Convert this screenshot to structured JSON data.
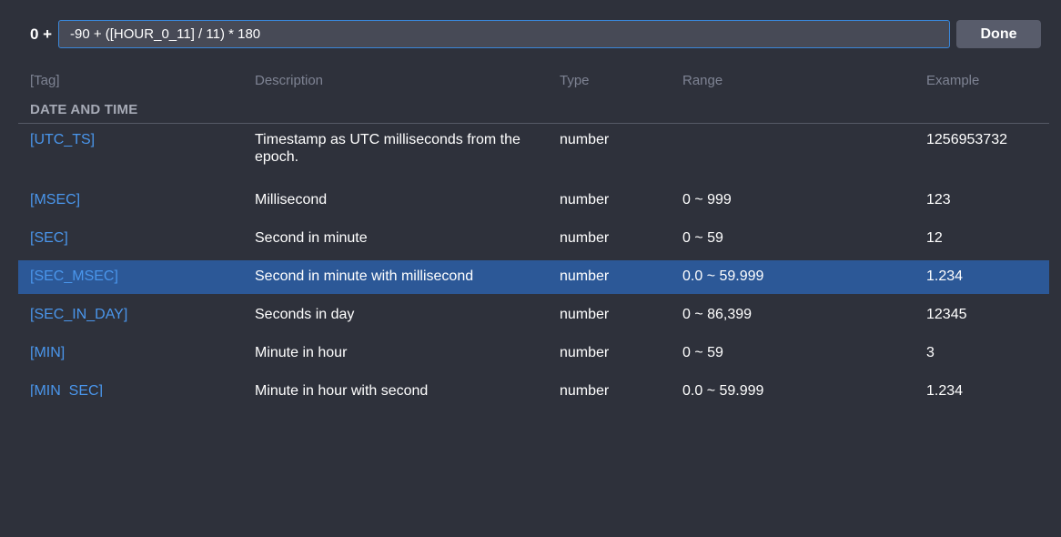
{
  "expression": {
    "prefix": "0 +",
    "value": "-90 + ([HOUR_0_11] / 11) * 180",
    "done_label": "Done"
  },
  "table": {
    "headers": {
      "tag": "[Tag]",
      "description": "Description",
      "type": "Type",
      "range": "Range",
      "example": "Example"
    },
    "group_title": "DATE AND TIME",
    "rows": [
      {
        "tag": "[UTC_TS]",
        "description": "Timestamp as UTC milliseconds from the epoch.",
        "type": "number",
        "range": "",
        "example": "1256953732"
      },
      {
        "tag": "[MSEC]",
        "description": "Millisecond",
        "type": "number",
        "range": "0 ~ 999",
        "example": "123"
      },
      {
        "tag": "[SEC]",
        "description": "Second in minute",
        "type": "number",
        "range": "0 ~ 59",
        "example": "12"
      },
      {
        "tag": "[SEC_MSEC]",
        "description": "Second in minute with millisecond",
        "type": "number",
        "range": "0.0 ~ 59.999",
        "example": "1.234",
        "selected": true
      },
      {
        "tag": "[SEC_IN_DAY]",
        "description": "Seconds in day",
        "type": "number",
        "range": "0 ~ 86,399",
        "example": "12345"
      },
      {
        "tag": "[MIN]",
        "description": "Minute in hour",
        "type": "number",
        "range": "0 ~ 59",
        "example": "3"
      },
      {
        "tag": "[MIN_SEC]",
        "description": "Minute in hour with second",
        "type": "number",
        "range": "0.0 ~ 59.999",
        "example": "1.234"
      }
    ]
  },
  "colors": {
    "background": "#2e313b",
    "input_border": "#3a86d8",
    "selected_row": "#2c5897",
    "tag_link": "#4a96ec"
  }
}
